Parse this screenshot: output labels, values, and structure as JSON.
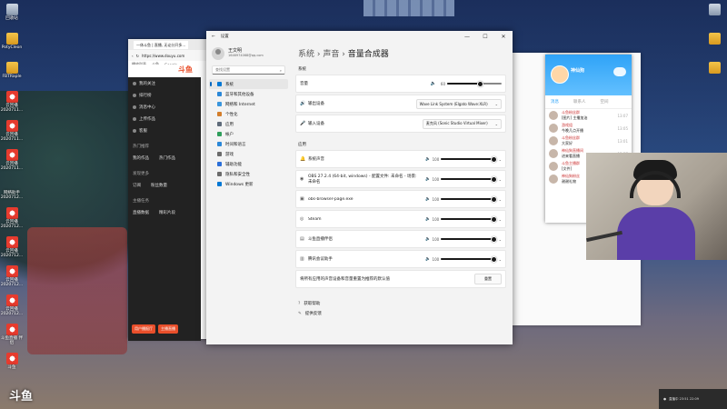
{
  "desktop": {
    "icons_left": [
      {
        "label": "回收站",
        "kind": "bin"
      },
      {
        "label": "PotyCleon",
        "kind": "folder"
      },
      {
        "label": "FBTRaple",
        "kind": "folder"
      },
      {
        "label": "云回播\n2020711...",
        "kind": "douyu"
      },
      {
        "label": "云回播\n2020711...",
        "kind": "douyu"
      },
      {
        "label": "云回播\n2020711...",
        "kind": "douyu"
      },
      {
        "label": "网络助手\n2020712...",
        "kind": "app"
      },
      {
        "label": "云回播\n2020712...",
        "kind": "douyu"
      },
      {
        "label": "云回播\n2020712...",
        "kind": "douyu"
      },
      {
        "label": "云回播\n2020712...",
        "kind": "douyu"
      },
      {
        "label": "云回播\n2020712...",
        "kind": "douyu"
      },
      {
        "label": "斗鱼直播\n伴侣",
        "kind": "douyu"
      },
      {
        "label": "斗鱼",
        "kind": "douyu"
      }
    ],
    "icons_right": [
      {
        "label": "",
        "kind": "bin"
      },
      {
        "label": "",
        "kind": "folder"
      },
      {
        "label": "",
        "kind": "folder"
      }
    ],
    "watermark": "斗鱼",
    "tray_text": "直播中 23:51 22:09"
  },
  "browser_left": {
    "tab_label": "一休斗鱼 | 直播, 无论分开多...",
    "url": "https://www.douyu.com",
    "bookmarks": [
      "播放列表",
      "斗鱼",
      "Google"
    ],
    "logo": "斗鱼",
    "menu": [
      "我的关注",
      "排行榜",
      "消息中心",
      "上传作品",
      "客服"
    ],
    "sections": [
      "热门推荐",
      "发现更多",
      "主播任务"
    ],
    "rows": [
      "我的作品",
      "热门作品",
      "订阅",
      "粉丝数量",
      "直播数据",
      "精彩片段"
    ],
    "btn_primary": "用户播报厅",
    "btn_secondary": "主播直播"
  },
  "qq": {
    "name": "神仙狗",
    "tabs": [
      "消息",
      "联系人",
      "空间"
    ],
    "chats": [
      {
        "name": "斗鱼粉丝群",
        "msg": "[图片] 主播加油",
        "time": "13:07"
      },
      {
        "name": "游戏组",
        "msg": "今晚几点开播",
        "time": "13:05"
      },
      {
        "name": "斗鱼粉丝群",
        "msg": "大家好",
        "time": "13:01"
      },
      {
        "name": "神仙狗直播间",
        "msg": "进来看直播",
        "time": "12:57"
      },
      {
        "name": "斗鱼主播群",
        "msg": "[文件]",
        "time": "12:44"
      },
      {
        "name": "神仙狗粉丝",
        "msg": "谢谢礼物",
        "time": "12:30"
      }
    ]
  },
  "settings": {
    "window_title": "设置",
    "user": {
      "name": "王文明",
      "email": "1646974068@qq.com"
    },
    "search_placeholder": "查找设置",
    "nav": [
      {
        "label": "系统",
        "color": "#0078d4",
        "active": true
      },
      {
        "label": "蓝牙和其他设备",
        "color": "#2b88d8",
        "active": false
      },
      {
        "label": "网络和 Internet",
        "color": "#3a96dd",
        "active": false
      },
      {
        "label": "个性化",
        "color": "#d47e2b",
        "active": false
      },
      {
        "label": "应用",
        "color": "#5f6b7a",
        "active": false
      },
      {
        "label": "帐户",
        "color": "#2f9e5b",
        "active": false
      },
      {
        "label": "时间和语言",
        "color": "#2b88d8",
        "active": false
      },
      {
        "label": "游戏",
        "color": "#6b6b6b",
        "active": false
      },
      {
        "label": "辅助功能",
        "color": "#2b6fd8",
        "active": false
      },
      {
        "label": "隐私和安全性",
        "color": "#6b6b6b",
        "active": false
      },
      {
        "label": "Windows 更新",
        "color": "#0078d4",
        "active": false
      }
    ],
    "breadcrumb": {
      "part1": "系统",
      "sep": "›",
      "part2": "声音",
      "sep2": "›",
      "current": "音量合成器"
    },
    "system_heading": "系统",
    "master": {
      "label": "音量",
      "value": "60",
      "max": 100
    },
    "output": {
      "label": "输出设备",
      "value": "Wave Link System (Elgato Wave:XLR)"
    },
    "input": {
      "label": "输入设备",
      "value": "麦克风 (Sonic Studio Virtual Mixer)"
    },
    "apps_heading": "应用",
    "apps": [
      {
        "name": "系统声音",
        "icon": "🔔",
        "volume": "100",
        "level": 0.97
      },
      {
        "name": "OBS 27.2.4 (64-bit, windows) - 配置文件: 未命名 - 场景: 未命名",
        "icon": "◉",
        "volume": "100",
        "level": 0.97
      },
      {
        "name": "obs-browser-page.exe",
        "icon": "▣",
        "volume": "100",
        "level": 0.97
      },
      {
        "name": "Steam",
        "icon": "◎",
        "volume": "100",
        "level": 0.97
      },
      {
        "name": "斗鱼直播伴侣",
        "icon": "▤",
        "volume": "100",
        "level": 0.97
      },
      {
        "name": "腾讯会议助手",
        "icon": "▥",
        "volume": "100",
        "level": 0.97
      }
    ],
    "reset_label": "将所有应用的声音设备和音量重置为推荐的默认值",
    "reset_button": "重置",
    "links": [
      {
        "label": "获取帮助",
        "icon": "?"
      },
      {
        "label": "提供反馈",
        "icon": "✎"
      }
    ]
  }
}
